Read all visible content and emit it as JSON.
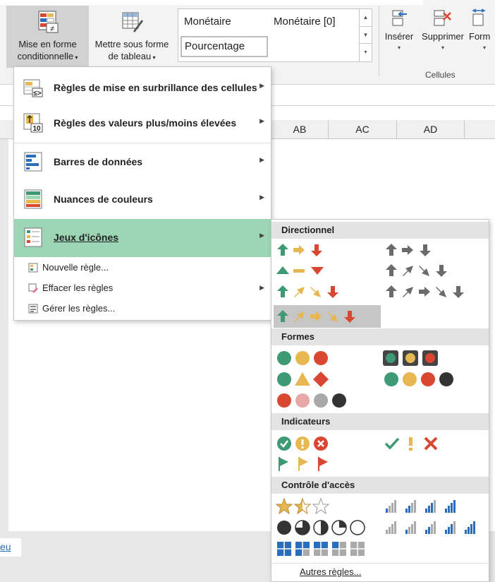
{
  "ribbon": {
    "mfc_line1": "Mise en forme",
    "mfc_line2": "conditionnelle",
    "mst_line1": "Mettre sous forme",
    "mst_line2": "de tableau",
    "styles": {
      "monetaire": "Monétaire",
      "monetaire0": "Monétaire [0]",
      "pourcentage": "Pourcentage"
    },
    "inserer": "Insérer",
    "supprimer": "Supprimer",
    "format": "Form",
    "group_cellules": "Cellules"
  },
  "columns": [
    "AB",
    "AC",
    "AD"
  ],
  "sheet_link": "eu",
  "menu": {
    "surbrillance": "Règles de mise en surbrillance des cellules",
    "valeurs": "Règles des valeurs plus/moins élevées",
    "barres": "Barres de données",
    "nuances": "Nuances de couleurs",
    "jeux": "Jeux d'icônes",
    "nouvelle": "Nouvelle règle...",
    "effacer": "Effacer les règles",
    "gerer": "Gérer les règles..."
  },
  "submenu": {
    "sections": [
      "Directionnel",
      "Formes",
      "Indicateurs",
      "Contrôle d'accès"
    ],
    "other": "Autres règles..."
  },
  "colors": {
    "green": "#3d9a74",
    "yellow": "#e7b852",
    "red": "#d94632",
    "gray": "#6b6b6b",
    "blue": "#2a6ebb",
    "highlight": "#9cd6b5"
  }
}
